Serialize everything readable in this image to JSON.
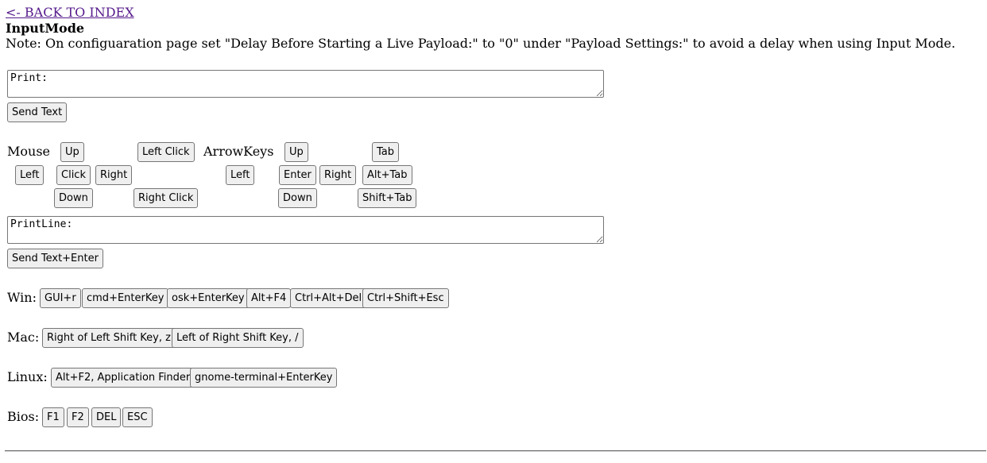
{
  "nav": {
    "back_link": "<- BACK TO INDEX"
  },
  "page": {
    "title": "InputMode",
    "note": "Note: On configuaration page set \"Delay Before Starting a Live Payload:\" to \"0\" under \"Payload Settings:\" to avoid a delay when using Input Mode."
  },
  "print": {
    "placeholder": "Print:",
    "value": "",
    "send_label": "Send Text"
  },
  "mouse": {
    "label": "Mouse",
    "up": "Up",
    "left": "Left",
    "click": "Click",
    "right": "Right",
    "down": "Down",
    "left_click": "Left Click",
    "right_click": "Right Click"
  },
  "arrows": {
    "label": "ArrowKeys",
    "left": "Left",
    "up": "Up",
    "enter": "Enter",
    "right": "Right",
    "down": "Down",
    "tab": "Tab",
    "alt_tab": "Alt+Tab",
    "shift_tab": "Shift+Tab"
  },
  "printline": {
    "placeholder": "PrintLine:",
    "value": "",
    "send_label": "Send Text+Enter"
  },
  "win": {
    "label": "Win:",
    "buttons": [
      "GUI+r",
      "cmd+EnterKey",
      "osk+EnterKey",
      "Alt+F4",
      "Ctrl+Alt+Del",
      "Ctrl+Shift+Esc"
    ]
  },
  "mac": {
    "label": "Mac:",
    "buttons": [
      "Right of Left Shift Key, z",
      "Left of Right Shift Key, /"
    ]
  },
  "linux": {
    "label": "Linux:",
    "buttons": [
      "Alt+F2, Application Finder",
      "gnome-terminal+EnterKey"
    ]
  },
  "bios": {
    "label": "Bios:",
    "buttons": [
      "F1",
      "F2",
      "DEL",
      "ESC"
    ]
  }
}
